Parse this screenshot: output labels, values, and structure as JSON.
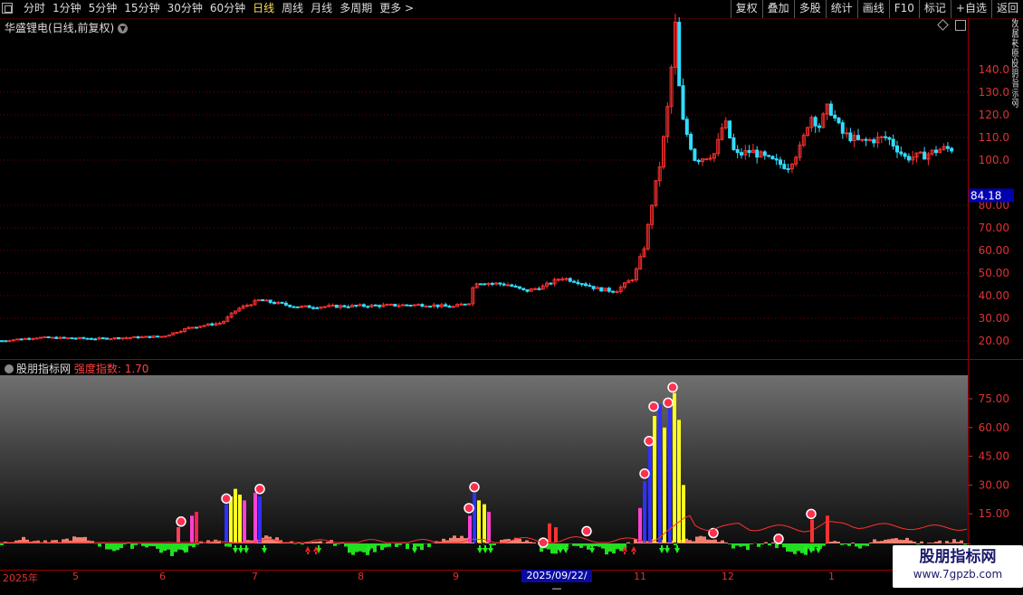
{
  "toolbar": {
    "periods": [
      "分时",
      "1分钟",
      "5分钟",
      "15分钟",
      "30分钟",
      "60分钟",
      "日线",
      "周线",
      "月线",
      "多周期",
      "更多 >"
    ],
    "active_period": "日线",
    "right_buttons": [
      "复权",
      "叠加",
      "多股",
      "统计",
      "画线",
      "F10",
      "标记",
      "+自选",
      "返回"
    ]
  },
  "main_chart": {
    "title": "华盛锂电(日线,前复权)",
    "y_ticks": [
      "140.0",
      "130.0",
      "120.0",
      "110.0",
      "100.0",
      "80.00",
      "70.00",
      "60.00",
      "50.00",
      "40.00",
      "30.00",
      "20.00"
    ],
    "current_price": "84.18",
    "colors": {
      "up": "#ff3030",
      "down": "#33ddff",
      "grid": "#7a0000",
      "price_tag_bg": "#0000b0"
    }
  },
  "sidebar_text": "数据来源股朋指标网",
  "indicator": {
    "name": "股朋指标网",
    "label": "强度指数: 1.70",
    "y_ticks": [
      "75.00",
      "60.00",
      "45.00",
      "30.00",
      "15.00"
    ]
  },
  "x_axis": {
    "labels": [
      "2025年",
      "5",
      "6",
      "7",
      "8",
      "9",
      "11",
      "12",
      "1"
    ],
    "crosshair_date": "2025/09/22/—"
  },
  "watermark": {
    "line1": "股朋指标网",
    "line2": "www.7gpzb.com"
  }
}
